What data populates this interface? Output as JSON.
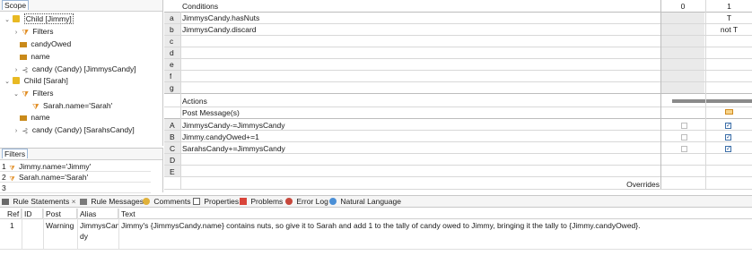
{
  "scope": {
    "tab_label": "Scope",
    "items": [
      {
        "label": "Child [Jimmy]"
      },
      {
        "label": "Filters"
      },
      {
        "label": "candyOwed"
      },
      {
        "label": "name"
      },
      {
        "label": "candy (Candy) [JimmysCandy]"
      },
      {
        "label": "Child [Sarah]"
      },
      {
        "label": "Filters"
      },
      {
        "label": "Sarah.name='Sarah'"
      },
      {
        "label": "name"
      },
      {
        "label": "candy (Candy) [SarahsCandy]"
      }
    ]
  },
  "filters": {
    "tab_label": "Filters",
    "rows": [
      {
        "num": "1",
        "text": "Jimmy.name='Jimmy'"
      },
      {
        "num": "2",
        "text": "Sarah.name='Sarah'"
      },
      {
        "num": "3",
        "text": ""
      }
    ]
  },
  "conditions": {
    "header": "Conditions",
    "col0": "0",
    "col1": "1",
    "rows": [
      {
        "letter": "a",
        "text": "JimmysCandy.hasNuts",
        "c1": "T"
      },
      {
        "letter": "b",
        "text": "JimmysCandy.discard",
        "c1": "not T"
      },
      {
        "letter": "c",
        "text": "",
        "c1": ""
      },
      {
        "letter": "d",
        "text": "",
        "c1": ""
      },
      {
        "letter": "e",
        "text": "",
        "c1": ""
      },
      {
        "letter": "f",
        "text": "",
        "c1": ""
      },
      {
        "letter": "g",
        "text": "",
        "c1": ""
      }
    ]
  },
  "actions": {
    "header": "Actions",
    "post_message_header": "Post Message(s)",
    "rows": [
      {
        "letter": "A",
        "text": "JimmysCandy-=JimmysCandy",
        "checked": true
      },
      {
        "letter": "B",
        "text": "Jimmy.candyOwed+=1",
        "checked": true
      },
      {
        "letter": "C",
        "text": "SarahsCandy+=JimmysCandy",
        "checked": true
      },
      {
        "letter": "D",
        "text": "",
        "checked": false
      },
      {
        "letter": "E",
        "text": "",
        "checked": false
      }
    ],
    "overrides_label": "Overrides"
  },
  "bottom_tabs": [
    {
      "label": "Rule Statements",
      "icon": "rule-statements-icon"
    },
    {
      "label": "Rule Messages",
      "icon": "rule-messages-icon"
    },
    {
      "label": "Comments",
      "icon": "comments-icon"
    },
    {
      "label": "Properties",
      "icon": "properties-icon"
    },
    {
      "label": "Problems",
      "icon": "problems-icon"
    },
    {
      "label": "Error Log",
      "icon": "error-log-icon"
    },
    {
      "label": "Natural Language",
      "icon": "natural-language-icon"
    }
  ],
  "rule_statements": {
    "columns": [
      "Ref",
      "ID",
      "Post",
      "Alias",
      "Text"
    ],
    "rows": [
      {
        "ref": "1",
        "id": "",
        "post": "Warning",
        "alias_line1": "JimmysCan",
        "alias_line2": "dy",
        "text": "Jimmy's {JimmysCandy.name} contains nuts, so give it to Sarah and add 1 to the tally of candy owed to Jimmy, bringing it the tally to {Jimmy.candyOwed}."
      }
    ]
  },
  "colors": {
    "folder": "#e8b923",
    "filter": "#e08a1e",
    "attribute": "#c98a1a",
    "checkbox_blue": "#3b6ea8",
    "grey_cell": "#eaeaea"
  }
}
